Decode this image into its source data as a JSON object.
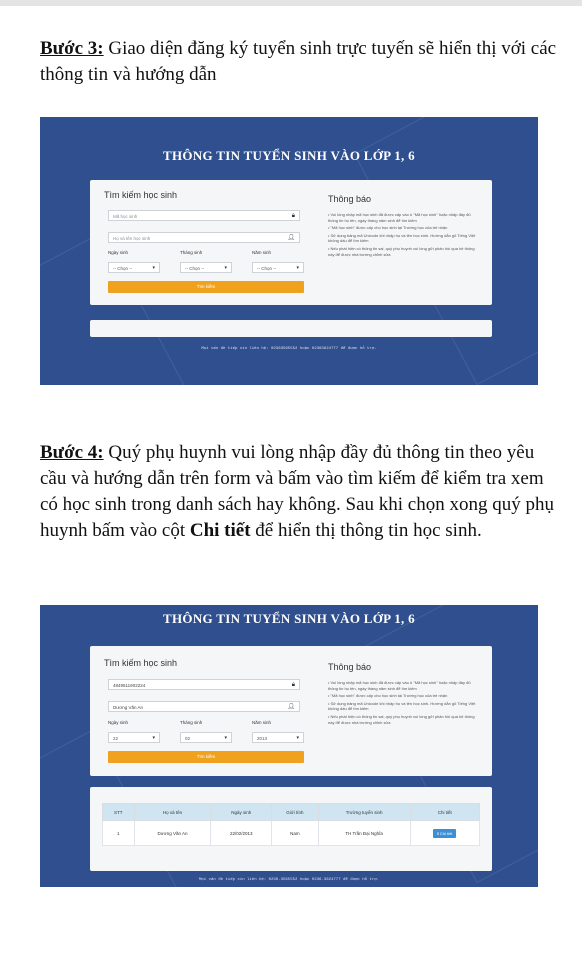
{
  "step3": {
    "label": "Bước 3:",
    "text": " Giao diện đăng ký tuyển sinh trực tuyến sẽ hiển thị với các thông tin và hướng dẫn"
  },
  "step4": {
    "label": "Bước 4:",
    "text_a": " Quý phụ huynh vui lòng nhập đầy đủ thông tin theo yêu cầu và hướng dẫn trên form và bấm vào tìm kiếm để kiểm tra xem có học sinh trong danh sách hay không. Sau khi chọn xong quý phụ huynh bấm vào cột ",
    "bold": "Chi tiết",
    "text_b": " để hiển thị thông tin học sinh."
  },
  "screen1": {
    "title": "THÔNG TIN TUYỂN SINH VÀO LỚP 1, 6",
    "search_heading": "Tìm kiếm học sinh",
    "student_id_placeholder": "Mã học sinh",
    "name_placeholder": "Họ và tên học sinh",
    "day_label": "Ngày sinh",
    "month_label": "Tháng sinh",
    "year_label": "Năm sinh",
    "day_value": "-- Chọn --",
    "month_value": "-- Chọn --",
    "year_value": "-- Chọn --",
    "search_button": "Tìm kiếm",
    "notice_heading": "Thông báo",
    "notices": [
      "• Vui lòng nhập mã học sinh đã được cấp vào ô \"Mã học sinh\" hoặc nhập đầy đủ thông tin họ tên, ngày tháng năm sinh để tìm kiếm",
      "• \"Mã học sinh\" được cấp cho học sinh tại Trường học của trẻ nhận",
      "• Sử dụng bảng mã Unicode khi nhập họ và tên học sinh. Hướng dẫn gõ Tiếng Việt không dấu để tìm kiếm",
      "• Nếu phát hiện có thông tin sai, quý phụ huynh vui lòng gửi phản hồi qua hệ thống này để được nhà trường chỉnh sửa"
    ],
    "footer": "Mọi vấn đề tiếp xin liên hệ: 02363565552 hoặc 02363624777 để được hỗ trợ."
  },
  "screen2": {
    "title": "THÔNG TIN TUYỂN SINH VÀO LỚP 1, 6",
    "search_heading": "Tìm kiếm học sinh",
    "student_id_value": "4849511902224",
    "name_value": "Dương Văn An",
    "day_label": "Ngày sinh",
    "month_label": "Tháng sinh",
    "year_label": "Năm sinh",
    "day_value": "22",
    "month_value": "02",
    "year_value": "2013",
    "search_button": "Tìm kiếm",
    "notice_heading": "Thông báo",
    "notices": [
      "• Vui lòng nhập mã học sinh đã được cấp vào ô \"Mã học sinh\" hoặc nhập đầy đủ thông tin họ tên, ngày tháng năm sinh để tìm kiếm",
      "• \"Mã học sinh\" được cấp cho học sinh tại Trường học của trẻ nhận",
      "• Sử dụng bảng mã Unicode khi nhập họ và tên học sinh. Hướng dẫn gõ Tiếng Việt không dấu để tìm kiếm",
      "• Nếu phát hiện có thông tin sai, quý phụ huynh vui lòng gửi phản hồi qua hệ thống này để được nhà trường chỉnh sửa"
    ],
    "table": {
      "headers": [
        "STT",
        "Họ và tên",
        "Ngày sinh",
        "Giới tính",
        "Trường tuyển sinh",
        "Chi tiết"
      ],
      "row": [
        "1",
        "Dương Văn An",
        "22/02/2013",
        "Nam",
        "TH Trần Đại Nghĩa"
      ],
      "detail_button": "Chi tiết"
    },
    "footer": "Mọi vấn đề tiếp xin liên hệ: 0236.3565552 hoặc 0236.3624777 để được hỗ trợ."
  }
}
